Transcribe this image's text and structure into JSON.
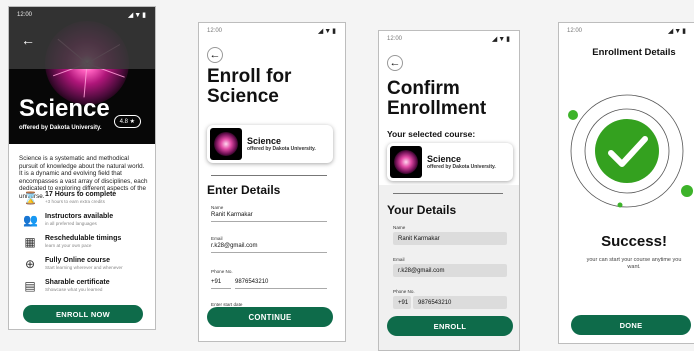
{
  "screens": {
    "detail": {
      "time": "12:00",
      "signal": "◢▼▮",
      "title": "Science",
      "offered_by": "offered by Dakota University.",
      "rating": "4.8 ★",
      "description": "Science is a systematic and methodical pursuit of knowledge about the natural world. It is a dynamic and evolving field that encompasses a vast array of disciplines, each dedicated to exploring different aspects of the universe.",
      "features": [
        {
          "title": "17 Hours to complete",
          "sub": "+3 hours to earn extra credits",
          "icon": "hourglass-icon",
          "glyph": "⌛"
        },
        {
          "title": "Instructors available",
          "sub": "in all preferred languages",
          "icon": "instructors-icon",
          "glyph": "👥"
        },
        {
          "title": "Reschedulable timings",
          "sub": "learn at your own pace",
          "icon": "calendar-icon",
          "glyph": "▦"
        },
        {
          "title": "Fully Online course",
          "sub": "Start learning wherever and whenever",
          "icon": "globe-icon",
          "glyph": "⊕"
        },
        {
          "title": "Sharable certificate",
          "sub": "Showcase what you learned",
          "icon": "certificate-icon",
          "glyph": "▤"
        }
      ],
      "button": "ENROLL NOW"
    },
    "enroll": {
      "time": "12:00",
      "signal": "◢▼▮",
      "heading": "Enroll for Science",
      "course_title": "Science",
      "course_sub": "offered by Dakota University.",
      "section": "Enter Details",
      "name_label": "Name",
      "name_value": "Ranit Karmakar",
      "email_label": "Email",
      "email_value": "r.k28@gmail.com",
      "phone_label": "Phone No.",
      "phone_code": "+91",
      "phone_value": "9876543210",
      "date_label": "Enter start date",
      "button": "CONTINUE"
    },
    "confirm": {
      "time": "12:00",
      "signal": "◢▼▮",
      "heading": "Confirm Enrollment",
      "selected_label": "Your selected course:",
      "course_title": "Science",
      "course_sub": "offered by Dakota University.",
      "section": "Your Details",
      "name_label": "Name",
      "name_value": "Ranit Karmakar",
      "email_label": "Email",
      "email_value": "r.k28@gmail.com",
      "phone_label": "Phone No.",
      "phone_code": "+91",
      "phone_value": "9876543210",
      "button": "ENROLL"
    },
    "success": {
      "time": "12:00",
      "signal": "◢▼▮",
      "title": "Enrollment Details",
      "heading": "Success!",
      "message": "your can start your course anytime you want.",
      "button": "DONE"
    }
  },
  "colors": {
    "accent": "#0e6b4a",
    "success": "#34a11f",
    "dot": "#3db32a"
  }
}
